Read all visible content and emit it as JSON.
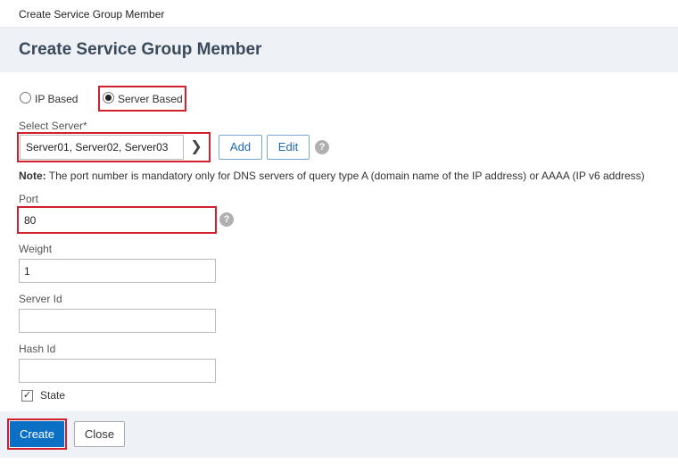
{
  "window": {
    "title": "Create Service Group Member"
  },
  "header": {
    "title": "Create Service Group Member"
  },
  "member_type": {
    "options": [
      {
        "label": "IP Based",
        "checked": false
      },
      {
        "label": "Server Based",
        "checked": true
      }
    ]
  },
  "select_server": {
    "label": "Select Server*",
    "value": "Server01, Server02, Server03",
    "add_label": "Add",
    "edit_label": "Edit"
  },
  "note": {
    "prefix": "Note:",
    "text": " The port number is mandatory only for DNS servers of query type A (domain name of the IP address) or AAAA (IP v6 address)"
  },
  "fields": {
    "port": {
      "label": "Port",
      "value": "80"
    },
    "weight": {
      "label": "Weight",
      "value": "1"
    },
    "server_id": {
      "label": "Server Id",
      "value": ""
    },
    "hash_id": {
      "label": "Hash Id",
      "value": ""
    }
  },
  "state": {
    "label": "State",
    "checked": true
  },
  "footer": {
    "create_label": "Create",
    "close_label": "Close"
  },
  "icons": {
    "help": "help-icon",
    "chevron": "chevron-right-icon",
    "check": "checkmark-icon"
  },
  "colors": {
    "highlight": "#d0202b",
    "primary_button": "#0b6fc4",
    "header_bg": "#eef1f6"
  }
}
